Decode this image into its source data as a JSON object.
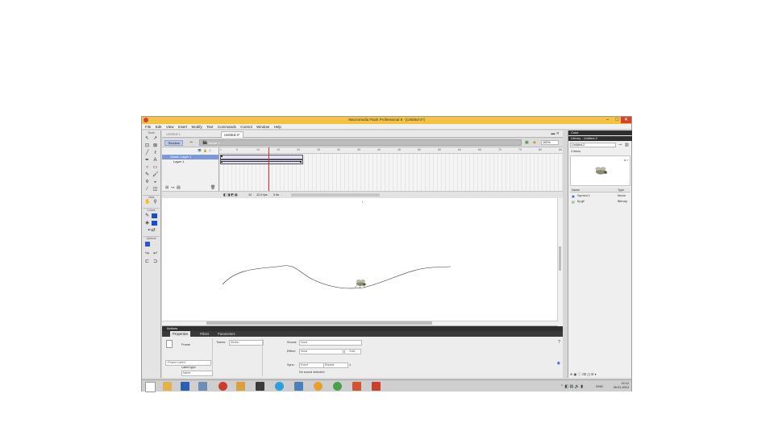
{
  "app": {
    "title": "Macromedia Flash Professional 8 - [Untitled-2*]",
    "minimize_glyph": "–",
    "maximize_glyph": "□",
    "close_glyph": "✕"
  },
  "menubar": [
    "File",
    "Edit",
    "View",
    "Insert",
    "Modify",
    "Text",
    "Commands",
    "Control",
    "Window",
    "Help"
  ],
  "tools": {
    "headers": {
      "tools": "Tools",
      "view": "View",
      "colors": "Colors",
      "options": "Options"
    }
  },
  "document": {
    "tabs": [
      "Untitled-1",
      "Untitled-2*"
    ],
    "active_tab": "Untitled-2*",
    "timeline_button": "Timeline",
    "scene_label": "Scene 1",
    "zoom": "100%"
  },
  "timeline": {
    "layers": [
      {
        "name": "Guide: Layer 1",
        "selected": true
      },
      {
        "name": "Layer 1",
        "selected": false
      }
    ],
    "ruler_ticks": [
      "1",
      "5",
      "10",
      "15",
      "20",
      "25",
      "30",
      "35",
      "40",
      "45",
      "50",
      "55",
      "60",
      "65",
      "70",
      "75",
      "80",
      "85",
      "90",
      "95",
      "100"
    ],
    "current_frame": "12",
    "fps": "12.0 fps",
    "elapsed": "0.9s"
  },
  "actions_panel": {
    "label": "Actions"
  },
  "panels": {
    "tabs": [
      "Properties",
      "Filters",
      "Parameters"
    ],
    "active": "Properties"
  },
  "properties": {
    "kind": "Frame",
    "tween_label": "Tween:",
    "tween_value": "Motion",
    "frame_label": "<Frame Label>",
    "label_type_label": "Label type:",
    "label_type_value": "Name",
    "sound_label": "Sound:",
    "sound_value": "None",
    "effect_label": "Effect:",
    "effect_value": "None",
    "edit_button": "Edit...",
    "sync_label": "Sync:",
    "sync_value": "Event",
    "repeat_value": "Repeat",
    "repeat_count": "1",
    "no_sound": "No sound selected"
  },
  "library": {
    "title": "Library - Untitled-2",
    "header_color": "Color",
    "document_select": "Untitled-2",
    "items_count": "2 items",
    "columns": {
      "name": "Name",
      "type": "Type"
    },
    "items": [
      {
        "name": "Symbol 1",
        "type": "Movie"
      },
      {
        "name": "fly.gif",
        "type": "Bitmap"
      }
    ]
  },
  "taskbar": {
    "language": "ENG",
    "time": "22:12",
    "date": "28-01-2014"
  },
  "colors": {
    "titlebar": "#f5c242",
    "selected_layer": "#7a9ad6",
    "tween_span": "#e4e0f7",
    "playhead": "#d23030",
    "guide_path": "#333333",
    "panel_dark": "#2f2f2f"
  }
}
